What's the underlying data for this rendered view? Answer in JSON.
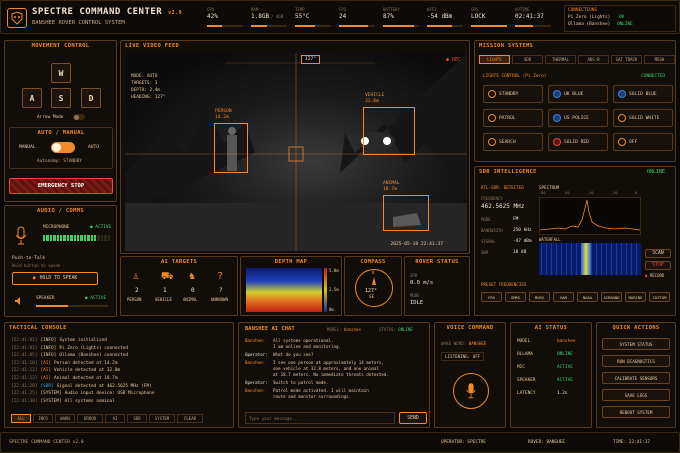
{
  "header": {
    "title": "SPECTRE COMMAND CENTER",
    "version": "v2.0",
    "subtitle": "BANSHEE ROVER CONTROL SYSTEM",
    "stats": [
      {
        "label": "CPU",
        "value": "42%",
        "fill": 0.42
      },
      {
        "label": "RAM",
        "value": "1.8GB",
        "unit": "/ 4GB",
        "fill": 0.45
      },
      {
        "label": "TEMP",
        "value": "55°C",
        "fill": 0.55
      },
      {
        "label": "FPS",
        "value": "24",
        "fill": 0.8
      },
      {
        "label": "BATTERY",
        "value": "87%",
        "fill": 0.87
      },
      {
        "label": "WIFI",
        "value": "-54 dBm",
        "fill": 0.7
      },
      {
        "label": "GPS",
        "value": "LOCK",
        "fill": 1
      },
      {
        "label": "UPTIME",
        "value": "02:41:37",
        "fill": 0.5
      }
    ],
    "connections_title": "CONNECTIONS",
    "connections": [
      {
        "name": "Pi Zero (Lights)",
        "status": "OK"
      },
      {
        "name": "Ollama (Banshee)",
        "status": "ONLINE"
      }
    ]
  },
  "movement": {
    "title": "MOVEMENT CONTROL",
    "keys": [
      "W",
      "A",
      "S",
      "D"
    ],
    "arrow_mode": "Arrow Mode",
    "auto_title": "AUTO / MANUAL",
    "manual": "MANUAL",
    "auto": "AUTO",
    "autonomy": "Autonomy: STANDBY",
    "estop": "EMERGENCY STOP"
  },
  "audio": {
    "title": "AUDIO / COMMS",
    "mic": "MICROPHONE",
    "mic_status": "ACTIVE",
    "ptt": "Push-to-Talk",
    "ptt_hint": "Hold button to speak",
    "hold": "HOLD TO SPEAK",
    "speaker": "SPEAKER",
    "speaker_status": "ACTIVE",
    "mic_level": 0.8,
    "speaker_level": 0.45
  },
  "video": {
    "title": "LIVE VIDEO FEED",
    "heading_box": "127°",
    "rec": "REC",
    "overlay": [
      "MODE: AUTO",
      "TARGETS: 3",
      "DEPTH: 2.4m",
      "HEADING: 127°"
    ],
    "labels": [
      {
        "name": "PERSON",
        "dist": "14.2m"
      },
      {
        "name": "VEHICLE",
        "dist": "32.8m"
      },
      {
        "name": "ANIMAL",
        "dist": "18.7m"
      }
    ],
    "timestamp": "2025-05-18 22:41:37",
    "compass_ticks": [
      "N",
      "NE",
      "E",
      "SE",
      "S",
      "SW",
      "W",
      "NW"
    ]
  },
  "ai_targets": {
    "title": "AI TARGETS",
    "items": [
      {
        "count": "2",
        "label": "PERSON"
      },
      {
        "count": "1",
        "label": "VEHICLE"
      },
      {
        "count": "0",
        "label": "ANIMAL"
      },
      {
        "count": "?",
        "label": "UNKNOWN"
      }
    ]
  },
  "depth": {
    "title": "DEPTH MAP",
    "scale": [
      "5.0m",
      "2.5m",
      "0m"
    ]
  },
  "compass": {
    "title": "COMPASS",
    "heading": "127°",
    "dir": "SE",
    "n": "N"
  },
  "rover": {
    "title": "ROVER STATUS",
    "spd_label": "SPD",
    "spd": "0.0 m/s",
    "mode_label": "MODE",
    "mode": "IDLE"
  },
  "mission": {
    "title": "MISSION SYSTEMS",
    "tabs": [
      "LIGHTS",
      "SDR",
      "THERMAL",
      "ADS-B",
      "SAT TRACK",
      "MESH"
    ],
    "lights_title": "LIGHTS CONTROL (Pi Zero)",
    "lights_status": "CONNECTED",
    "buttons": [
      {
        "label": "STANDBY",
        "style": ""
      },
      {
        "label": "UK BLUE",
        "style": "blue"
      },
      {
        "label": "SOLID BLUE",
        "style": "blue"
      },
      {
        "label": "PATROL",
        "style": ""
      },
      {
        "label": "US POLICE",
        "style": "blue"
      },
      {
        "label": "SOLID WHITE",
        "style": ""
      },
      {
        "label": "SEARCH",
        "style": ""
      },
      {
        "label": "SOLID RED",
        "style": "red"
      },
      {
        "label": "OFF",
        "style": ""
      }
    ]
  },
  "sdr": {
    "title": "SDR INTELLIGENCE",
    "status": "ONLINE",
    "detected": "RTL-SDR: DETECTED",
    "freq_label": "FREQUENCY",
    "freq": "462.5625 MHz",
    "mode_label": "MODE",
    "mode": "FM",
    "bw_label": "BANDWIDTH",
    "bw": "250 kHz",
    "sig_label": "SIGNAL",
    "sig": "-47 dBm",
    "snr_label": "SNR",
    "snr": "18 dB",
    "spectrum": "SPECTRUM",
    "waterfall": "WATERFALL",
    "scan": "SCAN",
    "stop": "STOP",
    "record": "RECORD",
    "db_ticks": [
      "-80",
      "-60",
      "-40",
      "-20",
      "0"
    ],
    "presets_title": "PRESET FREQUENCIES",
    "presets": [
      "FRS",
      "GMRS",
      "MURS",
      "HAM",
      "NOAA",
      "AIRBAND",
      "MARINE",
      "CUSTOM"
    ]
  },
  "console": {
    "title": "TACTICAL CONSOLE",
    "lines": [
      {
        "t": "[22:41:01]",
        "k": "[INFO]",
        "m": "System initialized"
      },
      {
        "t": "[22:41:02]",
        "k": "[INFO]",
        "m": "Pi Zero (Lights) connected"
      },
      {
        "t": "[22:41:05]",
        "k": "[INFO]",
        "m": "Ollama (Banshee) connected"
      },
      {
        "t": "[22:41:10]",
        "k": "[AI]",
        "m": "Person detected at 14.2m"
      },
      {
        "t": "[22:41:12]",
        "k": "[AI]",
        "m": "Vehicle detected at 32.8m"
      },
      {
        "t": "[22:41:13]",
        "k": "[AI]",
        "m": "Animal detected at 18.7m"
      },
      {
        "t": "[22:41:20]",
        "k": "[SDR]",
        "m": "Signal detected at 462.5625 MHz (FM)"
      },
      {
        "t": "[22:41:25]",
        "k": "[SYSTEM]",
        "m": "Audio input device: USB Microphone"
      },
      {
        "t": "[22:41:30]",
        "k": "[SYSTEM]",
        "m": "All systems nominal"
      }
    ],
    "filters": [
      "ALL",
      "INFO",
      "WARN",
      "ERROR",
      "AI",
      "SDR",
      "SYSTEM",
      "CLEAR"
    ]
  },
  "chat": {
    "title": "BANSHEE AI CHAT",
    "model_label": "MODEL:",
    "model": "banshee",
    "status_label": "STATUS:",
    "status": "ONLINE",
    "messages": [
      {
        "who": "Banshee:",
        "text": "All systems operational.\nI am online and monitoring."
      },
      {
        "who": "Operator:",
        "text": "What do you see?"
      },
      {
        "who": "Banshee:",
        "text": "I see one person at approximately 14 meters,\none vehicle at 32.8 meters, and one animal\nat 18.7 meters. No immediate threats detected."
      },
      {
        "who": "Operator:",
        "text": "Switch to patrol mode."
      },
      {
        "who": "Banshee:",
        "text": "Patrol mode activated. I will maintain\nroute and monitor surroundings."
      }
    ],
    "placeholder": "Type your message...",
    "send": "SEND"
  },
  "voice": {
    "title": "VOICE COMMAND",
    "wake_label": "WAKE WORD:",
    "wake": "BANSHEE",
    "listening": "LISTENING: OFF"
  },
  "ai_status": {
    "title": "AI STATUS",
    "rows": [
      {
        "k": "MODEL",
        "v": "banshee"
      },
      {
        "k": "OLLAMA",
        "v": "ONLINE"
      },
      {
        "k": "MIC",
        "v": "ACTIVE"
      },
      {
        "k": "SPEAKER",
        "v": "ACTIVE"
      },
      {
        "k": "LATENCY",
        "v": "1.2s"
      }
    ]
  },
  "quick": {
    "title": "QUICK ACTIONS",
    "buttons": [
      "SYSTEM STATUS",
      "RUN DIAGNOSTICS",
      "CALIBRATE SENSORS",
      "SAVE LOGS",
      "REBOOT SYSTEM"
    ]
  },
  "footer": {
    "left": "SPECTRE COMMAND CENTER v2.0",
    "operator": "OPERATOR: SPECTRE",
    "rover": "ROVER: BANSHEE",
    "time": "TIME: 22:41:37"
  },
  "colors": {
    "accent": "#f08a2a",
    "ok": "#3fd06a",
    "alert": "#e8453a",
    "bg": "#0a0806"
  }
}
